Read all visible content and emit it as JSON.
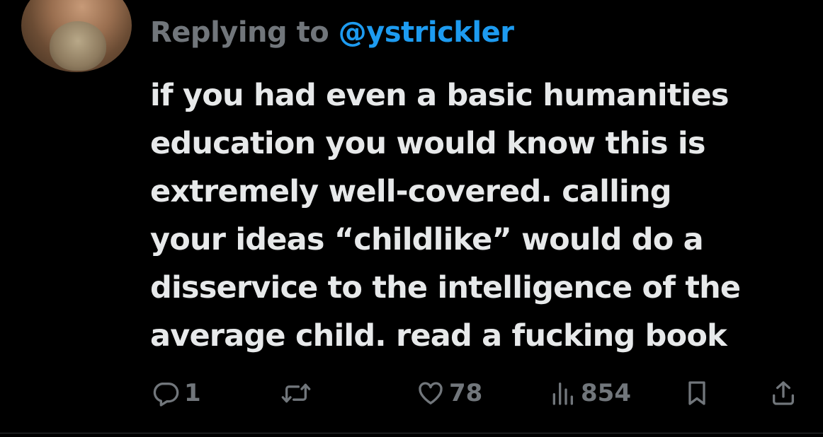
{
  "reply": {
    "label": "Replying to",
    "handle": "@ystrickler"
  },
  "tweet": {
    "lines": [
      "if you had even a basic humanities",
      "education you would know this is",
      "extremely well-covered. calling",
      "your ideas “childlike” would do a",
      "disservice to the intelligence of the",
      "average child. read a fucking book"
    ]
  },
  "actions": {
    "reply_icon": "reply-icon",
    "reply_count": "1",
    "retweet_icon": "retweet-icon",
    "like_icon": "heart-icon",
    "like_count": "78",
    "views_icon": "views-bar-icon",
    "views_count": "854",
    "bookmark_icon": "bookmark-icon",
    "share_icon": "share-icon"
  },
  "colors": {
    "background": "#000000",
    "text": "#e7e9ea",
    "muted": "#71767b",
    "accent": "#1d9bf0"
  }
}
